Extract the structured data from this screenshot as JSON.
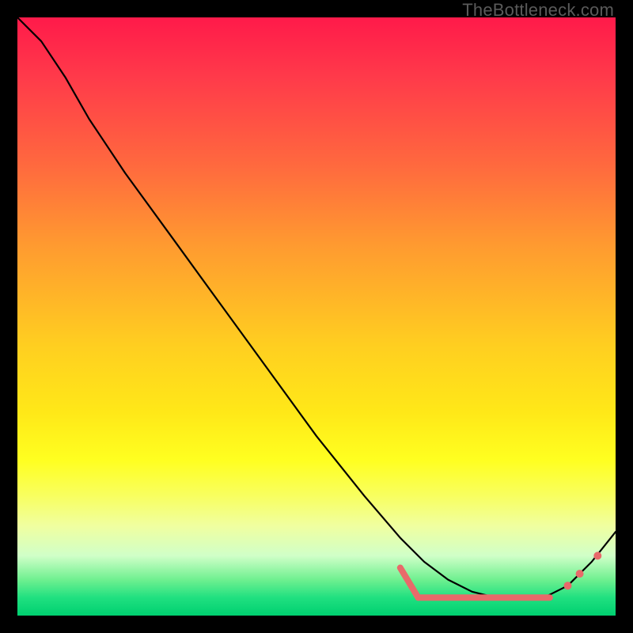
{
  "watermark": "TheBottleneck.com",
  "chart_data": {
    "type": "line",
    "title": "",
    "xlabel": "",
    "ylabel": "",
    "xlim": [
      0,
      100
    ],
    "ylim": [
      0,
      100
    ],
    "grid": false,
    "legend": false,
    "series": [
      {
        "name": "curve",
        "x": [
          0,
          4,
          8,
          12,
          18,
          26,
          34,
          42,
          50,
          58,
          64,
          68,
          72,
          76,
          80,
          84,
          88,
          92,
          96,
          100
        ],
        "y": [
          100,
          96,
          90,
          83,
          74,
          63,
          52,
          41,
          30,
          20,
          13,
          9,
          6,
          4,
          3,
          3,
          3,
          5,
          9,
          14
        ]
      }
    ],
    "highlight_band": {
      "x_start": 67,
      "x_end": 90,
      "y": 3
    },
    "highlight_dots": [
      {
        "x": 92,
        "y": 5
      },
      {
        "x": 94,
        "y": 7
      },
      {
        "x": 97,
        "y": 10
      }
    ],
    "colors": {
      "curve": "#000000",
      "markers": "#e86a6a",
      "gradient_top": "#ff1a4a",
      "gradient_mid": "#ffff20",
      "gradient_bottom": "#00d070"
    }
  }
}
